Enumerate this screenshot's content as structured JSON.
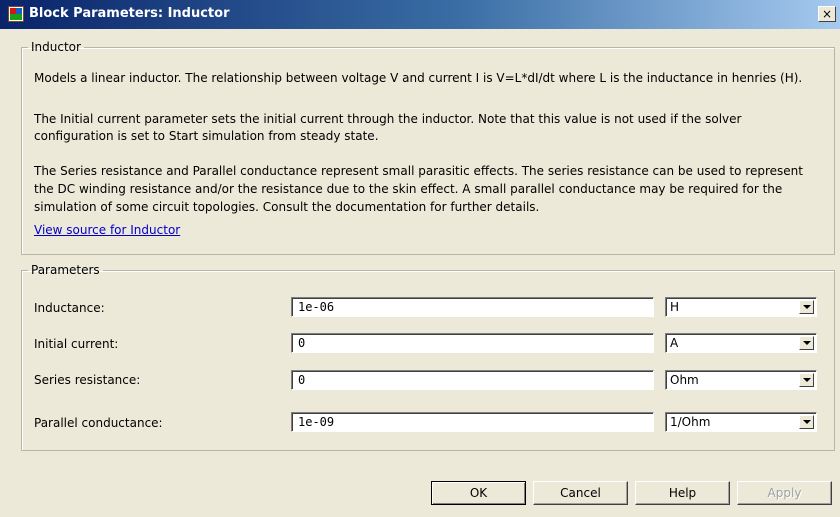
{
  "window": {
    "title": "Block Parameters: Inductor",
    "close_label": "×"
  },
  "inductor_section": {
    "legend": "Inductor",
    "paragraph_1": "Models a linear inductor. The relationship between voltage V and current I is V=L*dI/dt where L is the inductance in henries (H).",
    "paragraph_2_line_1": "The Initial current parameter sets the initial current through the inductor. Note that this value is not used if the solver",
    "paragraph_2_line_2": "configuration is set to Start simulation from steady state.",
    "paragraph_3_line_1": "The Series resistance and Parallel conductance represent small parasitic effects. The series resistance can be used to represent",
    "paragraph_3_line_2": "the DC winding resistance and/or the resistance due to the skin effect. A small parallel conductance may be required for the",
    "paragraph_3_line_3": "simulation of some circuit topologies. Consult the documentation for further details.",
    "source_link": "View source for Inductor"
  },
  "parameters_section": {
    "legend": "Parameters",
    "rows": [
      {
        "label": "Inductance:",
        "value": "1e-06",
        "unit": "H"
      },
      {
        "label": "Initial current:",
        "value": "0",
        "unit": "A"
      },
      {
        "label": "Series resistance:",
        "value": "0",
        "unit": "Ohm"
      },
      {
        "label": "Parallel conductance:",
        "value": "1e-09",
        "unit": "1/Ohm"
      }
    ]
  },
  "buttons": {
    "ok": "OK",
    "cancel": "Cancel",
    "help": "Help",
    "apply": "Apply"
  }
}
